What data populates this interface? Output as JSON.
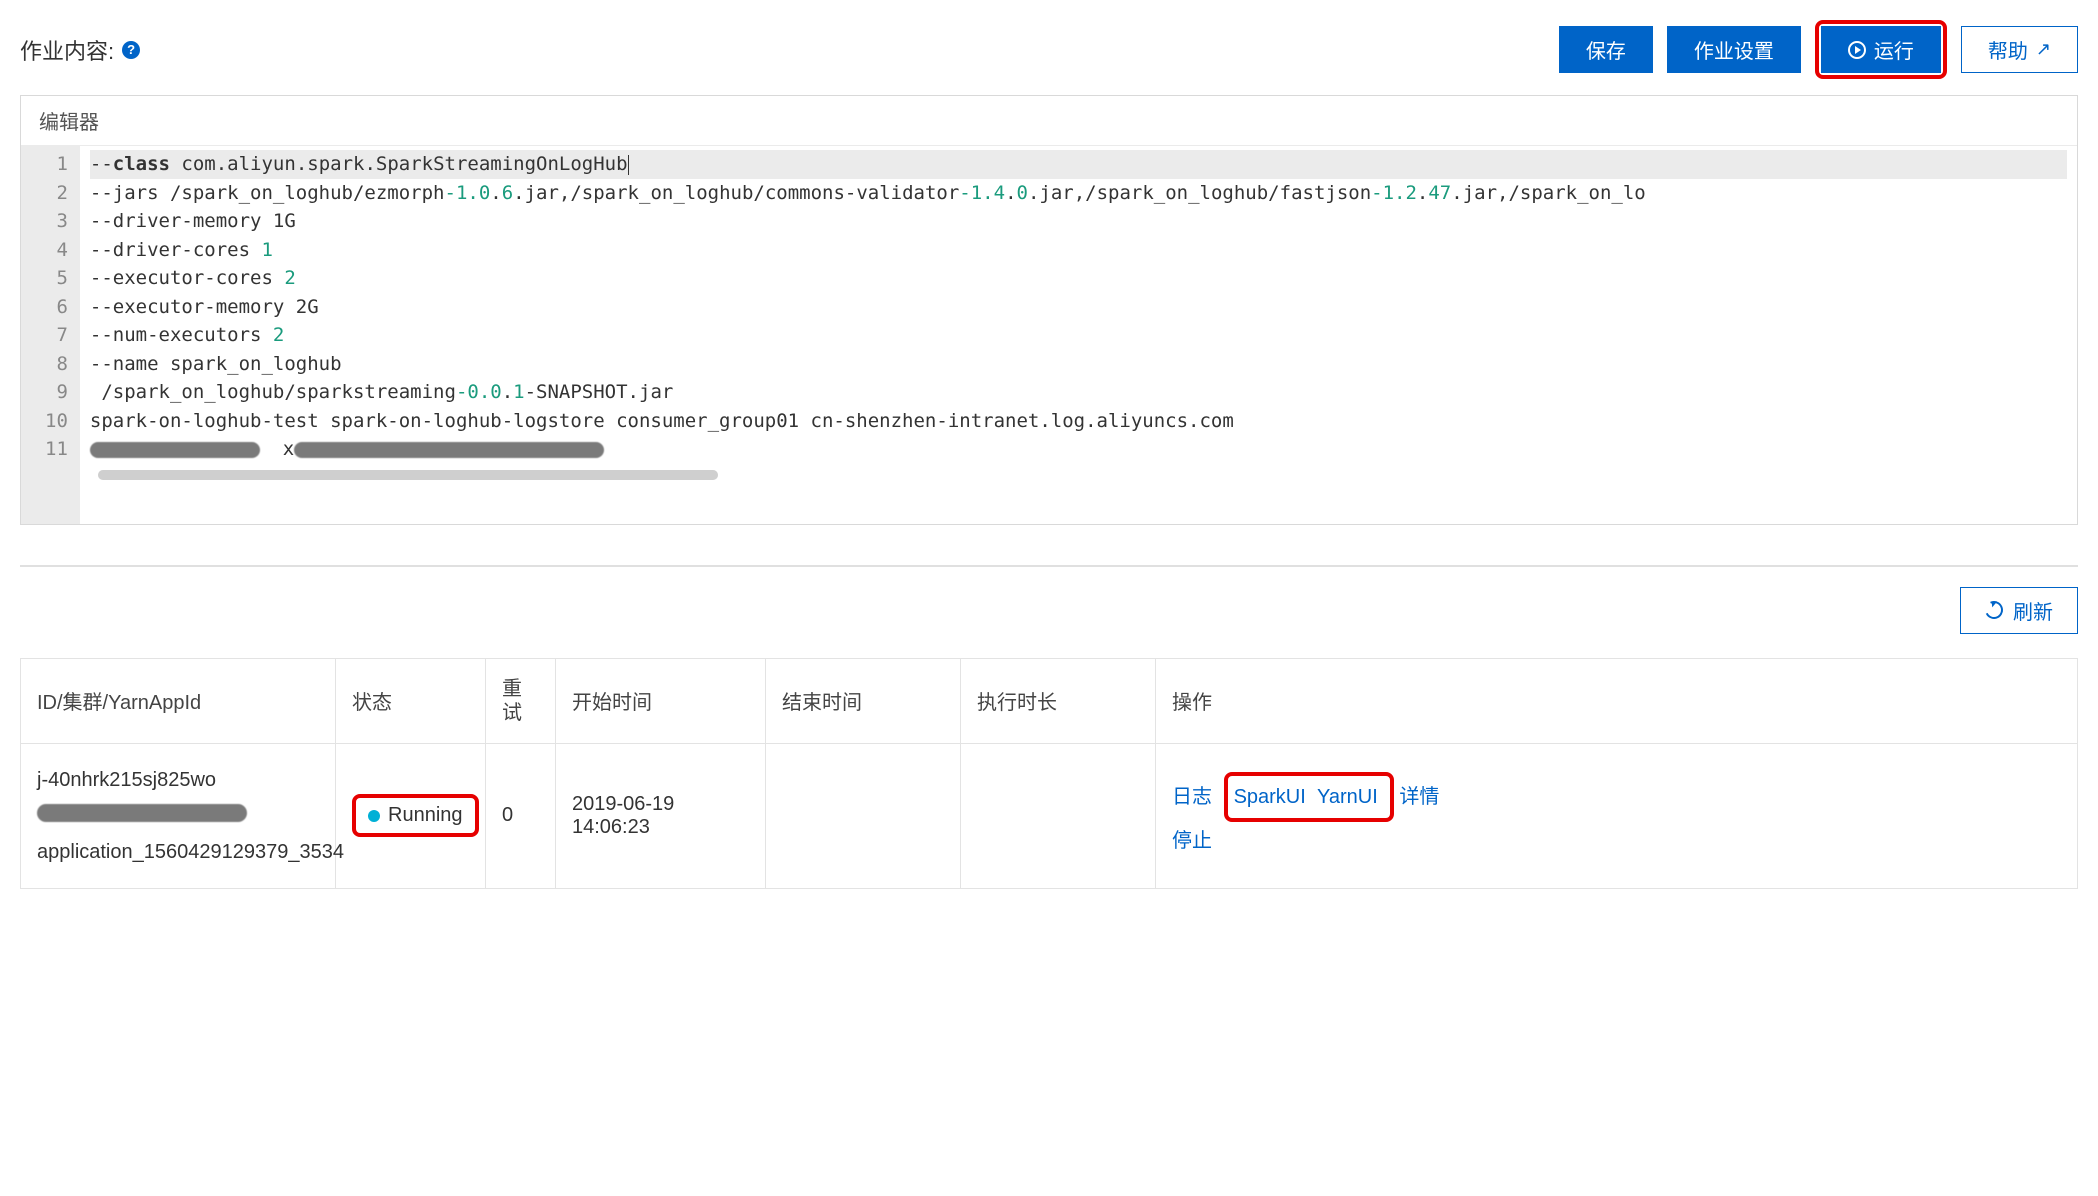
{
  "header": {
    "title": "作业内容:",
    "buttons": {
      "save": "保存",
      "settings": "作业设置",
      "run": "运行",
      "help": "帮助"
    }
  },
  "editor": {
    "tab_label": "编辑器",
    "lines": [
      "--class com.aliyun.spark.SparkStreamingOnLogHub",
      "--jars /spark_on_loghub/ezmorph-1.0.6.jar,/spark_on_loghub/commons-validator-1.4.0.jar,/spark_on_loghub/fastjson-1.2.47.jar,/spark_on_lo",
      "--driver-memory 1G",
      "--driver-cores 1",
      "--executor-cores 2",
      "--executor-memory 2G",
      "--num-executors 2",
      "--name spark_on_loghub",
      " /spark_on_loghub/sparkstreaming-0.0.1-SNAPSHOT.jar",
      "spark-on-loghub-test spark-on-loghub-logstore consumer_group01 cn-shenzhen-intranet.log.aliyuncs.com",
      ""
    ]
  },
  "actions": {
    "refresh": "刷新"
  },
  "jobs_table": {
    "headers": {
      "id": "ID/集群/YarnAppId",
      "status": "状态",
      "retry": "重试",
      "start": "开始时间",
      "end": "结束时间",
      "duration": "执行时长",
      "ops": "操作"
    },
    "row": {
      "id_line1": "j-40nhrk215sj825wo",
      "id_line3": "application_1560429129379_3534",
      "status": "Running",
      "retry": "0",
      "start_line1": "2019-06-19",
      "start_line2": "14:06:23",
      "end": "",
      "duration": "",
      "ops": {
        "log": "日志",
        "spark": "SparkUI",
        "yarn": "YarnUI",
        "detail": "详情",
        "stop": "停止"
      }
    }
  }
}
